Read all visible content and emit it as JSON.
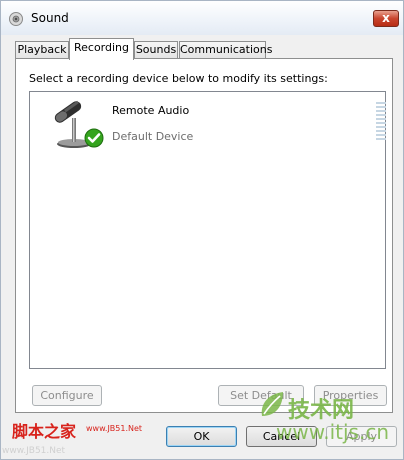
{
  "window": {
    "title": "Sound",
    "close_label": "x"
  },
  "tabs": [
    {
      "label": "Playback",
      "active": false
    },
    {
      "label": "Recording",
      "active": true
    },
    {
      "label": "Sounds",
      "active": false
    },
    {
      "label": "Communications",
      "active": false
    }
  ],
  "recording": {
    "instruction": "Select a recording device below to modify its settings:",
    "devices": [
      {
        "name": "Remote Audio",
        "status": "Default Device",
        "icon": "microphone-icon",
        "badge": "checkmark-icon"
      }
    ]
  },
  "buttons": {
    "configure": "Configure",
    "set_default": "Set Default",
    "properties": "Properties",
    "ok": "OK",
    "cancel": "Cancel",
    "apply": "Apply"
  },
  "watermarks": {
    "left_cn": "脚本之家",
    "left_url": "www.JB51.Net",
    "left_bottom": "www.JB51.Net",
    "right_cn": "技术网",
    "right_url": "www.itjs.cn"
  },
  "colors": {
    "panel_bg": "#ffffff",
    "window_bg": "#f0f0f0",
    "close_red": "#c9452e",
    "check_green": "#35a41e",
    "watermark_red": "#d8231c",
    "watermark_green": "#7ab648"
  }
}
